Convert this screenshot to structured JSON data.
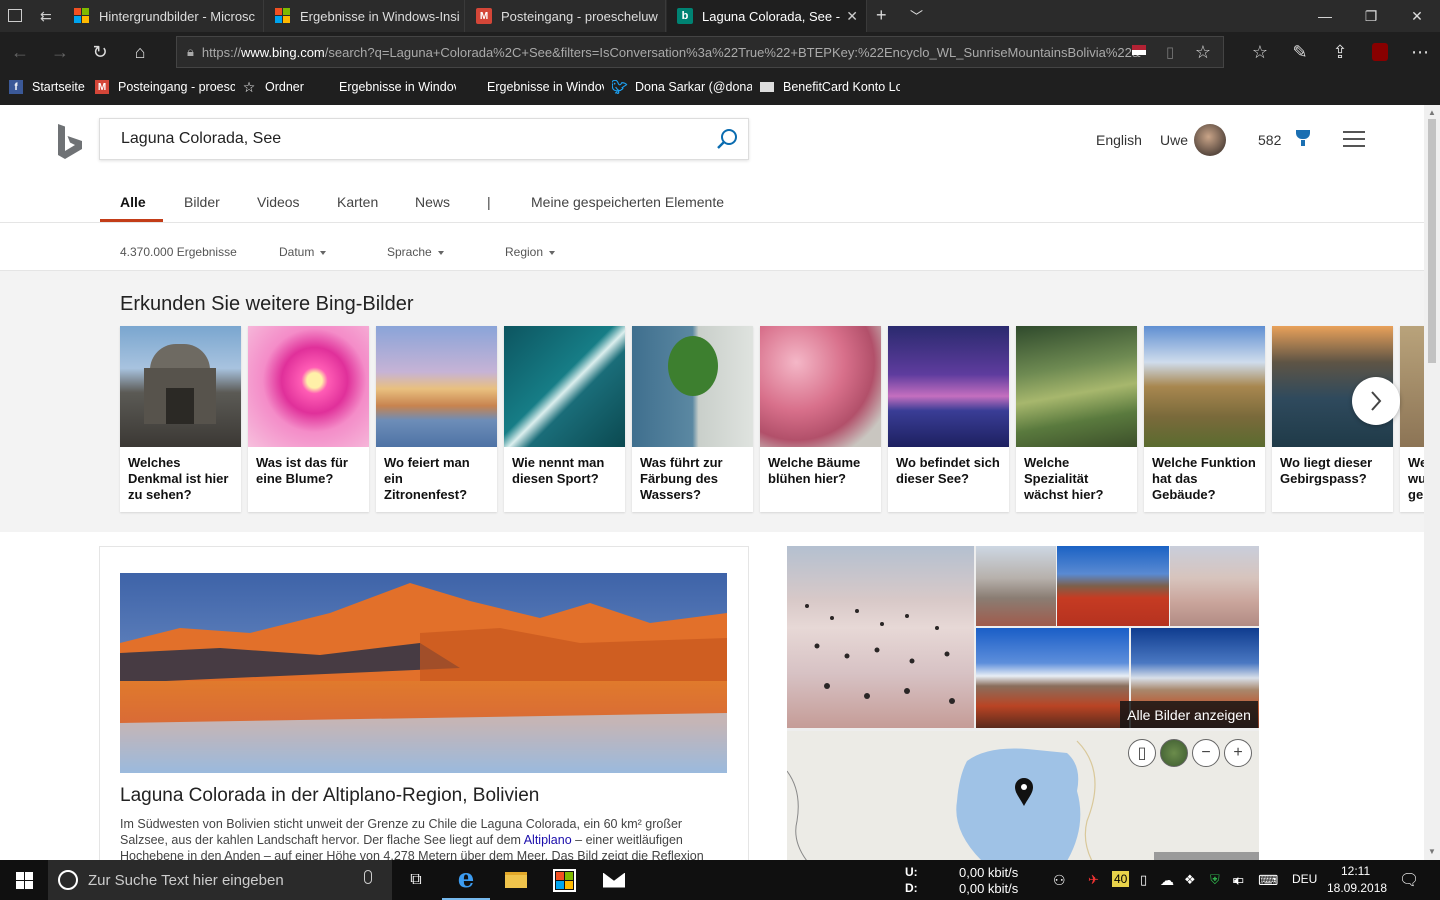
{
  "tabs": [
    {
      "title": "Hintergrundbilder - Microsc",
      "icon": "microsoft-icon"
    },
    {
      "title": "Ergebnisse in Windows-Insi",
      "icon": "microsoft-icon"
    },
    {
      "title": "Posteingang - proescheluw",
      "icon": "gmail-icon"
    },
    {
      "title": "Laguna Colorada, See -",
      "icon": "bing-icon"
    }
  ],
  "address": {
    "scheme": "https://",
    "host": "www.bing.com",
    "path": "/search?q=Laguna+Colorada%2C+See&filters=IsConversation%3a%22True%22+BTEPKey:%22Encyclo_WL_SunriseMountainsBolivia%22&"
  },
  "favorites": [
    {
      "label": "Startseite",
      "icon": "facebook-icon"
    },
    {
      "label": "Posteingang - proesc",
      "icon": "gmail-icon"
    },
    {
      "label": "Ordner",
      "icon": "star-icon"
    },
    {
      "label": "Ergebnisse in Windov",
      "icon": "microsoft-icon"
    },
    {
      "label": "Ergebnisse in Windov",
      "icon": "microsoft-icon"
    },
    {
      "label": "Dona Sarkar (@dona:",
      "icon": "twitter-icon"
    },
    {
      "label": "BenefitCard Konto Lo",
      "icon": "card-icon"
    }
  ],
  "search": {
    "query": "Laguna Colorada, See"
  },
  "header": {
    "language": "English",
    "user": "Uwe",
    "points": "582"
  },
  "scopes": [
    "Alle",
    "Bilder",
    "Videos",
    "Karten",
    "News",
    "|",
    "Meine gespeicherten Elemente"
  ],
  "filters": {
    "count": "4.370.000 Ergebnisse",
    "date": "Datum",
    "language": "Sprache",
    "region": "Region"
  },
  "carousel": {
    "title": "Erkunden Sie weitere Bing-Bilder",
    "cards": [
      "Welches Denkmal ist hier zu sehen?",
      "Was ist das für eine Blume?",
      "Wo feiert man ein Zitronenfest?",
      "Wie nennt man diesen Sport?",
      "Was führt zur Färbung des Wassers?",
      "Welche Bäume blühen hier?",
      "Wo befindet sich dieser See?",
      "Welche Spezialität wächst hier?",
      "Welche Funktion hat das Gebäude?",
      "Wo liegt dieser Gebirgspass?",
      "We wu ge"
    ]
  },
  "result": {
    "title": "Laguna Colorada in der Altiplano-Region, Bolivien",
    "desc_before": "Im Südwesten von Bolivien sticht unweit der Grenze zu Chile die Laguna Colorada, ein 60 km² großer Salzsee, aus der kahlen Landschaft hervor. Der flache See liegt auf dem ",
    "desc_link": "Altiplano",
    "desc_after": " – einer weitläufigen Hochebene in den Anden – auf einer Höhe von 4.278 Metern über dem Meer. Das Bild zeigt die Reflexion"
  },
  "gallery": {
    "all_images": "Alle Bilder anzeigen"
  },
  "taskbar": {
    "search_placeholder": "Zur Suche Text hier eingeben",
    "net_up_label": "U:",
    "net_down_label": "D:",
    "net_up": "0,00 kbit/s",
    "net_down": "0,00 kbit/s",
    "badge": "40",
    "lang": "DEU",
    "time": "12:11",
    "date": "18.09.2018"
  },
  "colors": {
    "accent": "#c33d18",
    "link": "#1a0dab",
    "bing_teal": "#008373"
  }
}
